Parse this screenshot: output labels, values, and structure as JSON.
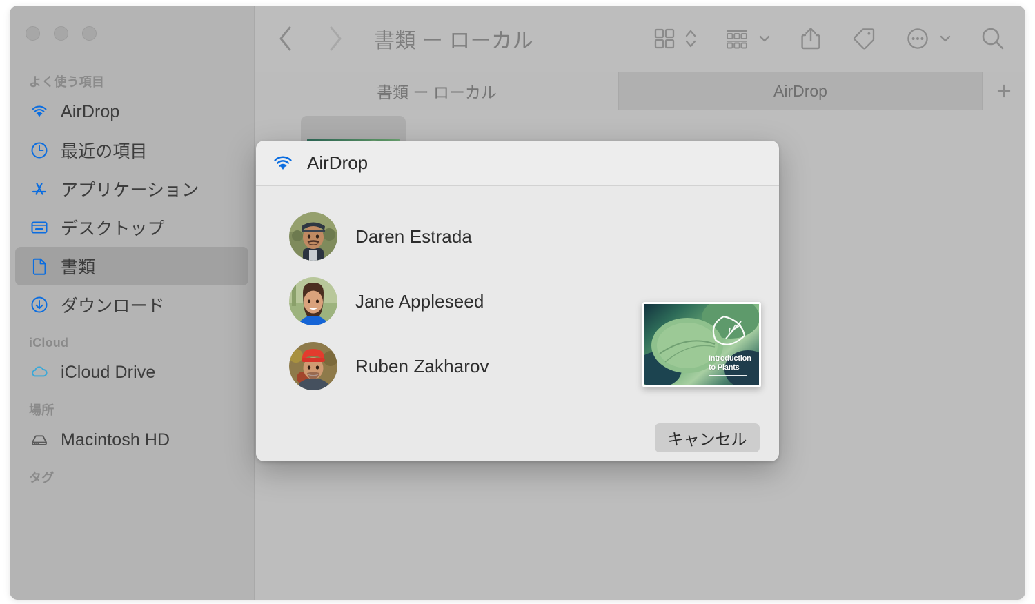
{
  "window": {
    "title": "書類 ー ローカル",
    "traffic_lights": [
      "close-button",
      "minimize-button",
      "zoom-button"
    ]
  },
  "sidebar": {
    "groups": [
      {
        "header": "よく使う項目",
        "items": [
          {
            "label": "AirDrop",
            "icon": "airdrop-icon",
            "selected": false
          },
          {
            "label": "最近の項目",
            "icon": "clock-icon",
            "selected": false
          },
          {
            "label": "アプリケーション",
            "icon": "applications-icon",
            "selected": false
          },
          {
            "label": "デスクトップ",
            "icon": "desktop-icon",
            "selected": false
          },
          {
            "label": "書類",
            "icon": "document-icon",
            "selected": true
          },
          {
            "label": "ダウンロード",
            "icon": "downloads-icon",
            "selected": false
          }
        ]
      },
      {
        "header": "iCloud",
        "items": [
          {
            "label": "iCloud Drive",
            "icon": "cloud-icon",
            "selected": false
          }
        ]
      },
      {
        "header": "場所",
        "items": [
          {
            "label": "Macintosh HD",
            "icon": "harddisk-icon",
            "selected": false
          }
        ]
      },
      {
        "header": "タグ",
        "items": []
      }
    ]
  },
  "toolbar": {
    "back": "back-chevron",
    "forward": "forward-chevron",
    "title": "書類 ー ローカル",
    "view_icon": "grid-view-icon",
    "view_stepper": "view-stepper-chevrons",
    "group_icon": "group-by-icon",
    "group_chevron": "chevron-down-icon",
    "share_icon": "share-icon",
    "tag_icon": "tag-icon",
    "more_icon": "more-ellipsis-icon",
    "more_chevron": "chevron-down-icon",
    "search_icon": "search-icon"
  },
  "tabs": [
    {
      "label": "書類 ー ローカル",
      "active": false
    },
    {
      "label": "AirDrop",
      "active": true
    }
  ],
  "tab_add_label": "+",
  "file_area": {
    "selected_file_thumbnail": "plants-document-thumbnail"
  },
  "dialog": {
    "icon": "airdrop-icon",
    "title": "AirDrop",
    "recipients": [
      {
        "name": "Daren Estrada",
        "avatar": "daren-avatar"
      },
      {
        "name": "Jane Appleseed",
        "avatar": "jane-avatar"
      },
      {
        "name": "Ruben Zakharov",
        "avatar": "ruben-avatar"
      }
    ],
    "drag_preview": {
      "name": "plants-document-preview",
      "caption_line1": "Introduction",
      "caption_line2": "to Plants"
    },
    "cancel_label": "キャンセル"
  },
  "colors": {
    "accent_blue": "#0b6de0",
    "sidebar_bg": "#b4b4b4",
    "sidebar_selected": "#a1a1a1",
    "content_bg": "#bdbdbd",
    "dialog_bg": "#e9e9e9",
    "dialog_titlebar": "#ededed",
    "button_bg": "#cdcdcd",
    "text_primary": "#2d2d2d",
    "text_secondary": "#7e7e7e",
    "toolbar_icon": "#8b8b8b"
  }
}
